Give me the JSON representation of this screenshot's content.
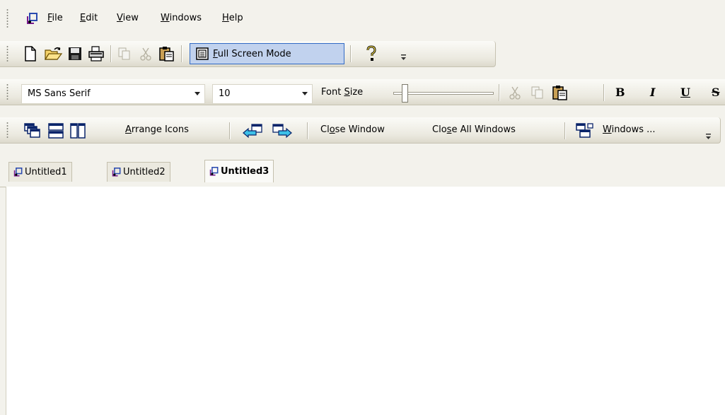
{
  "menu": {
    "items": [
      {
        "label_u": "F",
        "label_rest": "ile"
      },
      {
        "label_u": "E",
        "label_rest": "dit"
      },
      {
        "label_u": "V",
        "label_rest": "iew"
      },
      {
        "label_u": "W",
        "label_rest": "indows"
      },
      {
        "label_u": "H",
        "label_rest": "elp"
      }
    ]
  },
  "standard_toolbar": {
    "full_screen_u": "F",
    "full_screen_rest": "ull Screen Mode",
    "icons": [
      "new-file-icon",
      "open-folder-icon",
      "save-icon",
      "print-icon",
      "copy-icon",
      "cut-icon",
      "paste-icon",
      "full-screen-icon",
      "help-icon"
    ]
  },
  "format_toolbar": {
    "font_name": "MS Sans Serif",
    "font_size": "10",
    "font_size_label_pre": "Font ",
    "font_size_label_u": "S",
    "font_size_label_post": "ize",
    "bold": "B",
    "italic": "I",
    "underline": "U",
    "strike": "S"
  },
  "window_toolbar": {
    "arrange_u": "A",
    "arrange_rest": "rrange Icons",
    "close_window_pre": "Cl",
    "close_window_u": "o",
    "close_window_post": "se Window",
    "close_all_pre": "Clo",
    "close_all_u": "s",
    "close_all_post": "e All Windows",
    "windows_u": "W",
    "windows_rest": "indows ..."
  },
  "tabs": [
    {
      "label": "Untitled1",
      "active": false
    },
    {
      "label": "Untitled2",
      "active": false
    },
    {
      "label": "Untitled3",
      "active": true
    }
  ]
}
